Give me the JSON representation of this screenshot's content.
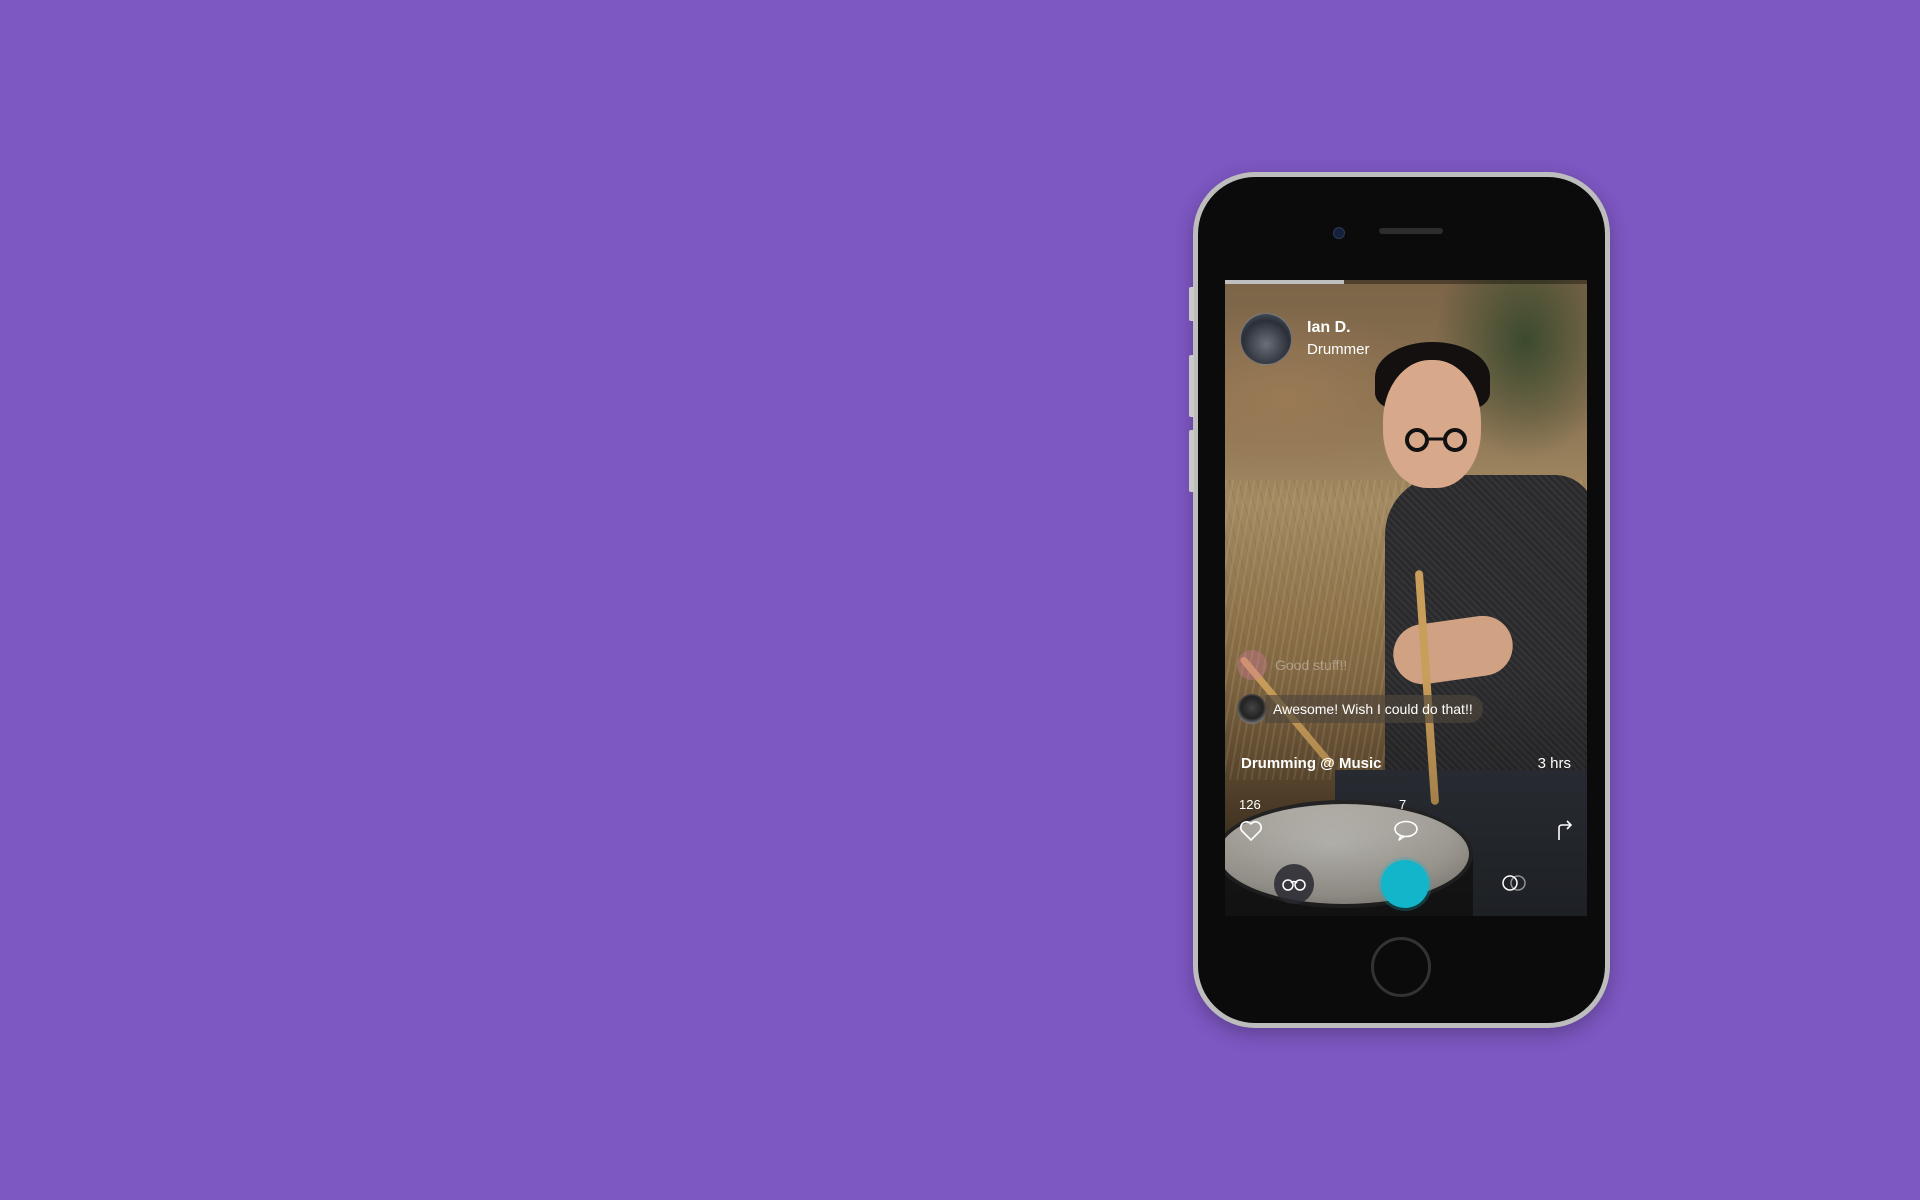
{
  "post": {
    "user_name": "Ian D.",
    "user_role": "Drummer",
    "title": "Drumming @ Music",
    "time_ago": "3 hrs",
    "likes_count": "126",
    "comments_count": "7",
    "progress_fraction": 0.33
  },
  "comments": [
    {
      "text": "Good stuff!!",
      "state": "faded"
    },
    {
      "text": "Awesome! Wish I could do that!!",
      "state": "active"
    }
  ],
  "icons": {
    "like": "heart-icon",
    "comment": "speech-bubble-icon",
    "share": "share-arrow-icon",
    "glasses": "glasses-icon",
    "record": "record-button",
    "overlap": "overlap-circles-icon"
  },
  "colors": {
    "background": "#7d57c2",
    "record_button": "#12b5c9",
    "phone_frame": "#bdbdbd"
  }
}
